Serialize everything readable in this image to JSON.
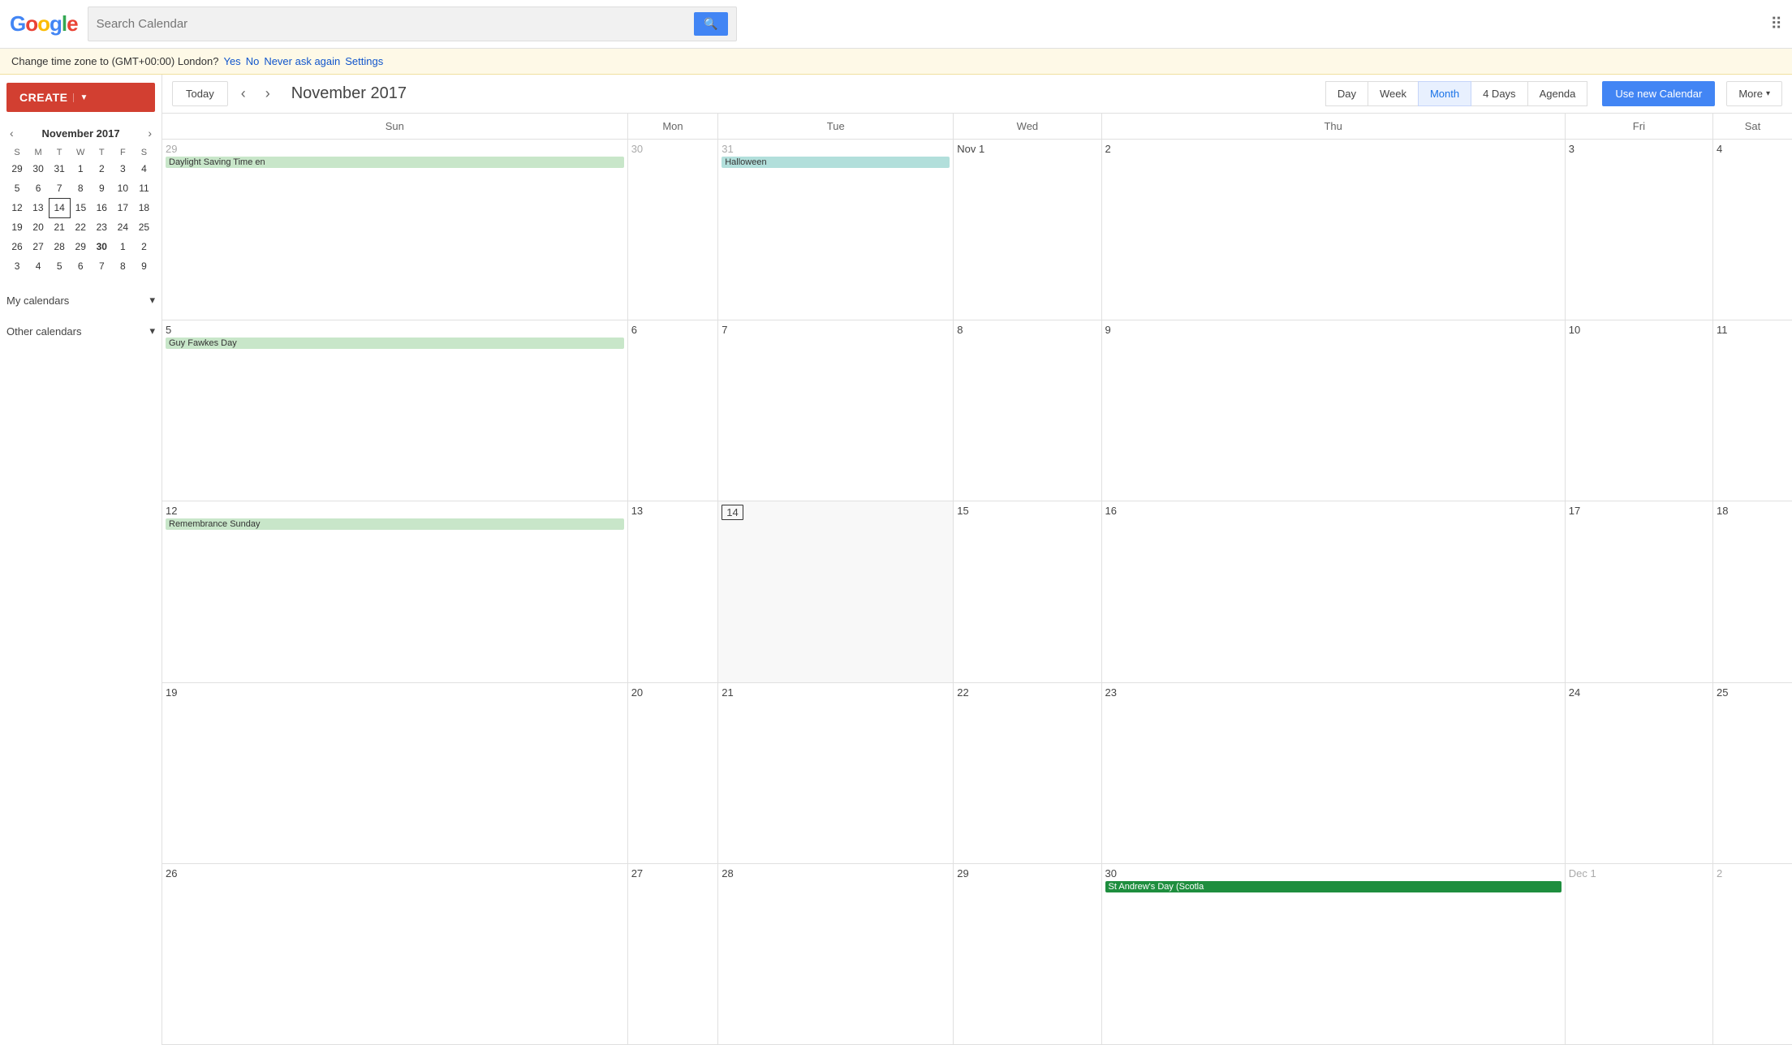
{
  "header": {
    "logo_text": "Google",
    "search_placeholder": "Search Calendar",
    "grid_icon": "⊞"
  },
  "tz_banner": {
    "text": "Change time zone to (GMT+00:00) London?",
    "yes": "Yes",
    "no": "No",
    "never": "Never ask again",
    "settings": "Settings"
  },
  "toolbar": {
    "today_label": "Today",
    "month_title": "November 2017",
    "views": [
      "Day",
      "Week",
      "Month",
      "4 Days",
      "Agenda"
    ],
    "active_view": "Month",
    "use_new_cal": "Use new Calendar",
    "more": "More"
  },
  "sidebar": {
    "create_label": "CREATE",
    "mini_cal": {
      "title": "November 2017",
      "days_of_week": [
        "S",
        "M",
        "T",
        "W",
        "T",
        "F",
        "S"
      ],
      "weeks": [
        [
          {
            "d": "29",
            "other": true
          },
          {
            "d": "30",
            "other": true
          },
          {
            "d": "31",
            "other": true
          },
          {
            "d": "1"
          },
          {
            "d": "2"
          },
          {
            "d": "3"
          },
          {
            "d": "4"
          }
        ],
        [
          {
            "d": "5"
          },
          {
            "d": "6"
          },
          {
            "d": "7"
          },
          {
            "d": "8"
          },
          {
            "d": "9"
          },
          {
            "d": "10"
          },
          {
            "d": "11"
          }
        ],
        [
          {
            "d": "12"
          },
          {
            "d": "13"
          },
          {
            "d": "14",
            "today": true
          },
          {
            "d": "15"
          },
          {
            "d": "16"
          },
          {
            "d": "17"
          },
          {
            "d": "18"
          }
        ],
        [
          {
            "d": "19"
          },
          {
            "d": "20"
          },
          {
            "d": "21"
          },
          {
            "d": "22"
          },
          {
            "d": "23"
          },
          {
            "d": "24"
          },
          {
            "d": "25"
          }
        ],
        [
          {
            "d": "26"
          },
          {
            "d": "27"
          },
          {
            "d": "28"
          },
          {
            "d": "29"
          },
          {
            "d": "30",
            "bold": true
          },
          {
            "d": "1",
            "other": true
          },
          {
            "d": "2",
            "other": true
          }
        ],
        [
          {
            "d": "3",
            "other": true
          },
          {
            "d": "4",
            "other": true
          },
          {
            "d": "5",
            "other": true
          },
          {
            "d": "6",
            "other": true
          },
          {
            "d": "7",
            "other": true
          },
          {
            "d": "8",
            "other": true
          },
          {
            "d": "9",
            "other": true
          }
        ]
      ]
    },
    "my_calendars": "My calendars",
    "other_calendars": "Other calendars"
  },
  "calendar": {
    "headers": [
      "Sun",
      "Mon",
      "Tue",
      "Wed",
      "Thu",
      "Fri",
      "Sat"
    ],
    "rows": [
      [
        {
          "d": "29",
          "other": true,
          "events": [
            {
              "label": "Daylight Saving Time en",
              "cls": "event-green"
            }
          ]
        },
        {
          "d": "30",
          "other": true,
          "events": []
        },
        {
          "d": "31",
          "other": true,
          "events": [
            {
              "label": "Halloween",
              "cls": "event-teal"
            }
          ]
        },
        {
          "d": "Nov 1",
          "events": []
        },
        {
          "d": "2",
          "events": []
        },
        {
          "d": "3",
          "events": []
        },
        {
          "d": "4",
          "events": []
        }
      ],
      [
        {
          "d": "5",
          "events": [
            {
              "label": "Guy Fawkes Day",
              "cls": "event-green"
            }
          ]
        },
        {
          "d": "6",
          "events": []
        },
        {
          "d": "7",
          "events": []
        },
        {
          "d": "8",
          "events": []
        },
        {
          "d": "9",
          "events": []
        },
        {
          "d": "10",
          "events": []
        },
        {
          "d": "11",
          "events": []
        }
      ],
      [
        {
          "d": "12",
          "events": [
            {
              "label": "Remembrance Sunday",
              "cls": "event-green"
            }
          ]
        },
        {
          "d": "13",
          "events": []
        },
        {
          "d": "14",
          "today": true,
          "events": []
        },
        {
          "d": "15",
          "events": []
        },
        {
          "d": "16",
          "events": []
        },
        {
          "d": "17",
          "events": []
        },
        {
          "d": "18",
          "events": []
        }
      ],
      [
        {
          "d": "19",
          "events": []
        },
        {
          "d": "20",
          "events": []
        },
        {
          "d": "21",
          "events": []
        },
        {
          "d": "22",
          "events": []
        },
        {
          "d": "23",
          "events": []
        },
        {
          "d": "24",
          "events": []
        },
        {
          "d": "25",
          "events": []
        }
      ],
      [
        {
          "d": "26",
          "events": []
        },
        {
          "d": "27",
          "events": []
        },
        {
          "d": "28",
          "events": []
        },
        {
          "d": "29",
          "events": []
        },
        {
          "d": "30",
          "events": [
            {
              "label": "St Andrew's Day (Scotla",
              "cls": "event-dark-green"
            }
          ]
        },
        {
          "d": "Dec 1",
          "other": true,
          "events": []
        },
        {
          "d": "2",
          "other": true,
          "events": []
        }
      ]
    ]
  }
}
